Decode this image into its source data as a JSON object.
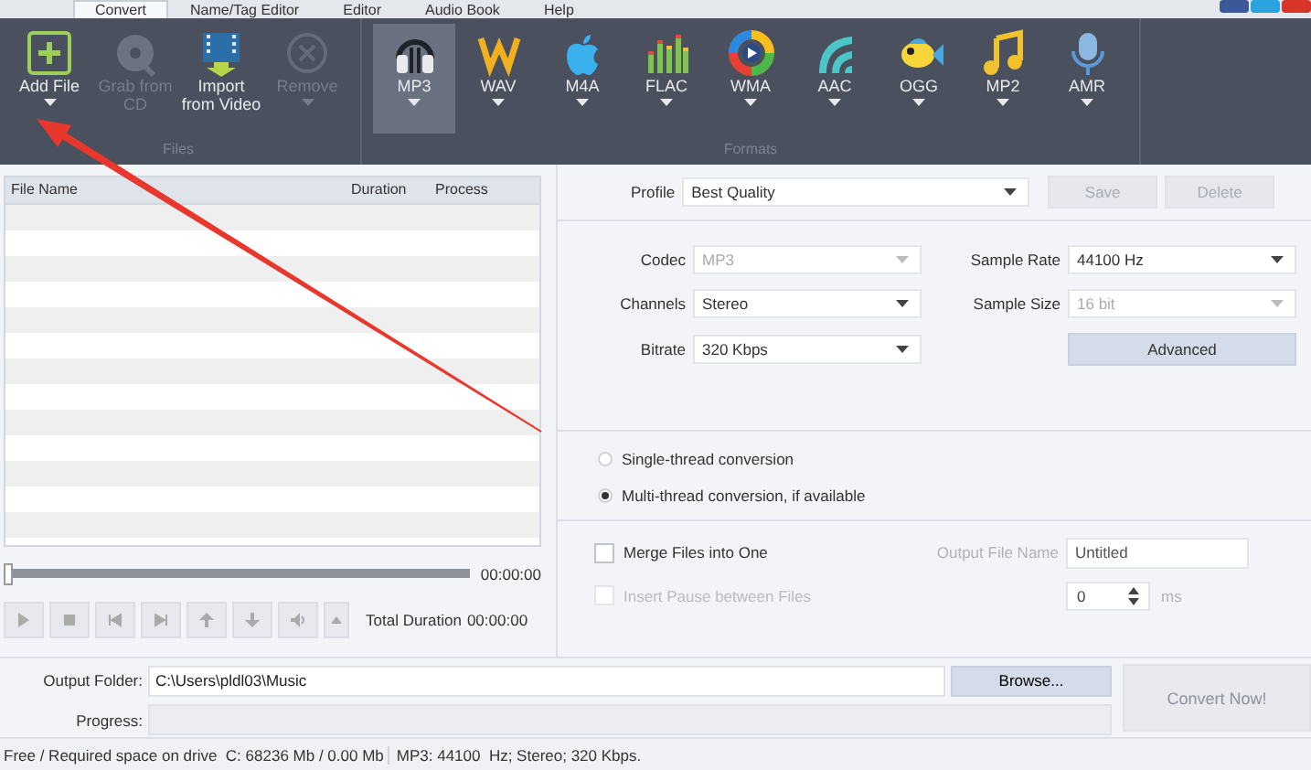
{
  "menu_tabs": [
    {
      "label": "Convert",
      "selected": true
    },
    {
      "label": "Name/Tag Editor",
      "selected": false
    },
    {
      "label": "Editor",
      "selected": false
    },
    {
      "label": "Audio Book",
      "selected": false
    },
    {
      "label": "Help",
      "selected": false
    }
  ],
  "toolbar": {
    "files_group": {
      "label": "Files",
      "buttons": [
        {
          "kind": "add",
          "label": "Add File",
          "disabled": false
        },
        {
          "kind": "cd",
          "label": "Grab from CD",
          "disabled": true
        },
        {
          "kind": "video",
          "label": "Import from Video",
          "disabled": false
        },
        {
          "kind": "remove",
          "label": "Remove",
          "disabled": true
        }
      ]
    },
    "formats_group": {
      "label": "Formats",
      "formats": [
        {
          "kind": "headphones",
          "label": "MP3",
          "selected": true
        },
        {
          "kind": "letter",
          "label": "WAV",
          "selected": false
        },
        {
          "kind": "fruit",
          "label": "M4A",
          "selected": false
        },
        {
          "kind": "bars",
          "label": "FLAC",
          "selected": false
        },
        {
          "kind": "disc",
          "label": "WMA",
          "selected": false
        },
        {
          "kind": "waves",
          "label": "AAC",
          "selected": false
        },
        {
          "kind": "fish",
          "label": "OGG",
          "selected": false
        },
        {
          "kind": "note",
          "label": "MP2",
          "selected": false
        },
        {
          "kind": "mic",
          "label": "AMR",
          "selected": false
        }
      ]
    }
  },
  "file_table": {
    "columns": [
      "File Name",
      "Duration",
      "Process"
    ]
  },
  "player": {
    "seek": {
      "level": 0,
      "time": "00:00:00"
    },
    "total_duration_label": "Total Duration",
    "total_duration": "00:00:00"
  },
  "settings": {
    "profile": {
      "label": "Profile",
      "value": "Best Quality"
    },
    "profile_buttons": [
      {
        "label": "Save",
        "disabled": true
      },
      {
        "label": "Delete",
        "disabled": true
      }
    ],
    "fields": [
      {
        "label": "Codec",
        "value": "MP3",
        "disabled": true
      },
      {
        "label": "Sample Rate",
        "value": "44100 Hz",
        "disabled": false
      },
      {
        "label": "Channels",
        "value": "Stereo",
        "disabled": false
      },
      {
        "label": "Sample Size",
        "value": "16 bit",
        "disabled": true
      },
      {
        "label": "Bitrate",
        "value": "320 Kbps",
        "disabled": false
      }
    ],
    "advanced_button": "Advanced",
    "threads": [
      {
        "label": "Single-thread conversion",
        "selected": false
      },
      {
        "label": "Multi-thread conversion, if available",
        "selected": true
      }
    ],
    "merge": {
      "label": "Merge Files into One",
      "checked": false,
      "disabled": false
    },
    "output_file_name": {
      "label": "Output File Name",
      "value": "Untitled"
    },
    "insert_pause": {
      "label": "Insert Pause between Files",
      "checked": false,
      "disabled": true
    },
    "pause": {
      "value": "0",
      "unit": "ms"
    }
  },
  "output": {
    "folder_label": "Output Folder:",
    "folder": "C:\\Users\\pldl03\\Music",
    "browse": "Browse...",
    "progress_label": "Progress:",
    "progress": {
      "level": 0
    },
    "convert": {
      "label": "Convert Now!",
      "disabled": true
    }
  },
  "status_bar": [
    "Free / Required space on drive  C: 68236 Mb / 0.00 Mb",
    "MP3: 44100  Hz; Stereo; 320 Kbps."
  ]
}
